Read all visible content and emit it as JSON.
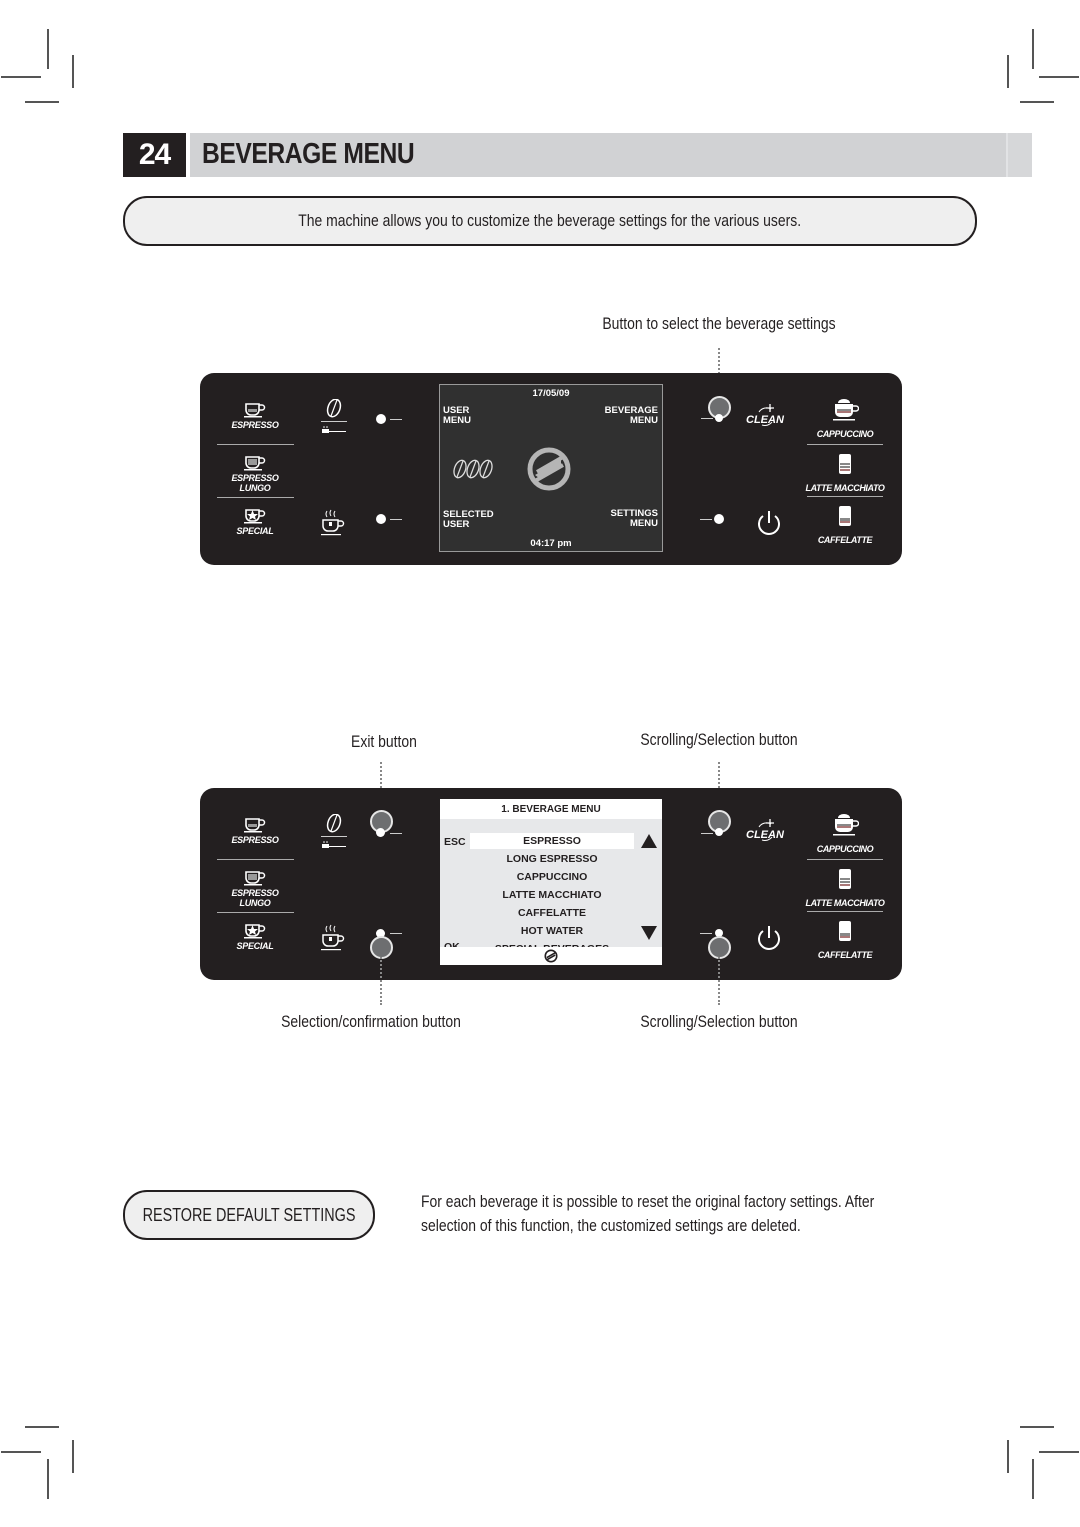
{
  "header": {
    "page_number": "24",
    "title": "BEVERAGE MENU"
  },
  "intro": "The machine allows you to customize the beverage settings for the various users.",
  "panel1": {
    "caption_top_right": "Button to select the beverage settings",
    "left_beverages": [
      {
        "label": "ESPRESSO",
        "icon": "espresso-cup-icon"
      },
      {
        "label": "ESPRESSO LUNGO",
        "icon": "espresso-lungo-cup-icon"
      },
      {
        "label": "SPECIAL",
        "icon": "special-star-cup-icon"
      }
    ],
    "right_beverages": [
      {
        "label": "CAPPUCCINO",
        "icon": "cappuccino-cup-icon"
      },
      {
        "label": "LATTE MACCHIATO",
        "icon": "latte-macchiato-glass-icon"
      },
      {
        "label": "CAFFELATTE",
        "icon": "caffelatte-glass-icon"
      }
    ],
    "clean_label": "CLEAN",
    "screen": {
      "date": "17/05/09",
      "top_left": [
        "USER",
        "MENU"
      ],
      "top_right": [
        "BEVERAGE",
        "MENU"
      ],
      "bottom_left": [
        "SELECTED",
        "USER"
      ],
      "bottom_right": [
        "SETTINGS",
        "MENU"
      ],
      "time": "04:17 pm",
      "strength_icon": "three-beans-icon",
      "logo_icon": "saeco-logo-icon"
    }
  },
  "panel2": {
    "caption_exit": "Exit button",
    "caption_scroll_top": "Scrolling/Selection button",
    "caption_select_confirm": "Selection/confirmation button",
    "caption_scroll_bottom": "Scrolling/Selection button",
    "screen": {
      "title": "1. BEVERAGE MENU",
      "esc_label": "ESC",
      "ok_label": "OK",
      "items": [
        "ESPRESSO",
        "LONG ESPRESSO",
        "CAPPUCCINO",
        "LATTE MACCHIATO",
        "CAFFELATTE",
        "HOT WATER",
        "SPECIAL BEVERAGES"
      ],
      "selected_index": 0
    }
  },
  "restore": {
    "label": "RESTORE DEFAULT SETTINGS",
    "description": "For each beverage it is possible to reset the original factory settings. After selection of this function, the customized settings are deleted."
  }
}
